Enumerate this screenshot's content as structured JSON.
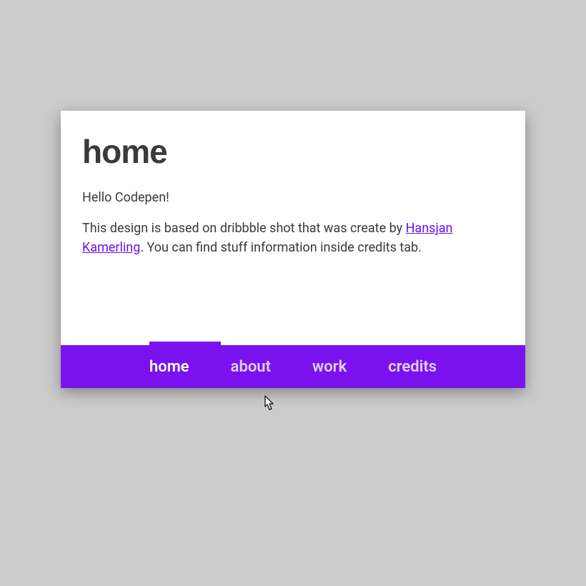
{
  "card": {
    "title": "home",
    "greeting": "Hello Codepen!",
    "description_prefix": "This design is based on dribbble shot that was create by ",
    "link_text": "Hansjan Kamerling",
    "description_suffix": ". You can find stuff information inside credits tab."
  },
  "nav": {
    "tabs": [
      {
        "label": "home",
        "active": true
      },
      {
        "label": "about",
        "active": false
      },
      {
        "label": "work",
        "active": false
      },
      {
        "label": "credits",
        "active": false
      }
    ]
  },
  "colors": {
    "accent": "#7a12ef",
    "background": "#cccccc",
    "text": "#3a3a3a"
  }
}
